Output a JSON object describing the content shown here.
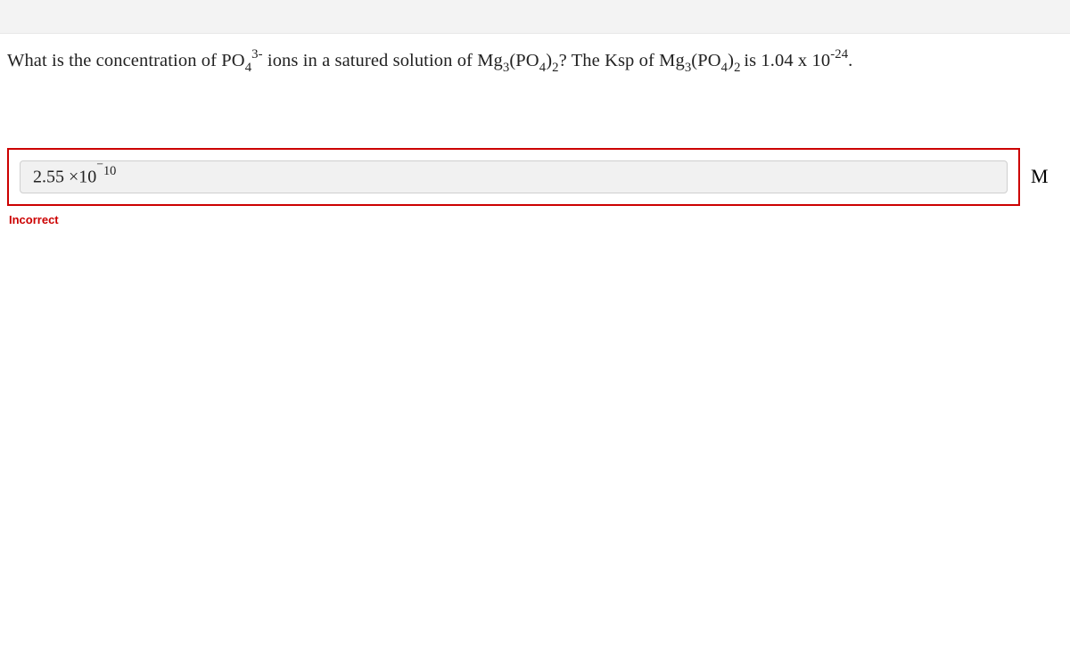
{
  "question": {
    "pre": "What is the concentration of PO",
    "po4_sub": "4",
    "po4_sup": "3-",
    "mid1": " ions in a satured solution of Mg",
    "mg_sub1": "3",
    "mid2": "(PO",
    "po4b_sub": "4",
    "mid3": ")",
    "close_sub1": "2",
    "mid4": "?  The Ksp of Mg",
    "mg_sub2": "3",
    "mid5": "(PO",
    "po4c_sub": "4",
    "mid6": ")",
    "close_sub2": "2 ",
    "mid7": "is 1.04 x 10",
    "ksp_sup": "-24",
    "tail": "."
  },
  "answer": {
    "coeff": "2.55",
    "times": " ×10",
    "exp_neg_sign": "−",
    "exp_digits": "10"
  },
  "unit": "M",
  "feedback": "Incorrect"
}
